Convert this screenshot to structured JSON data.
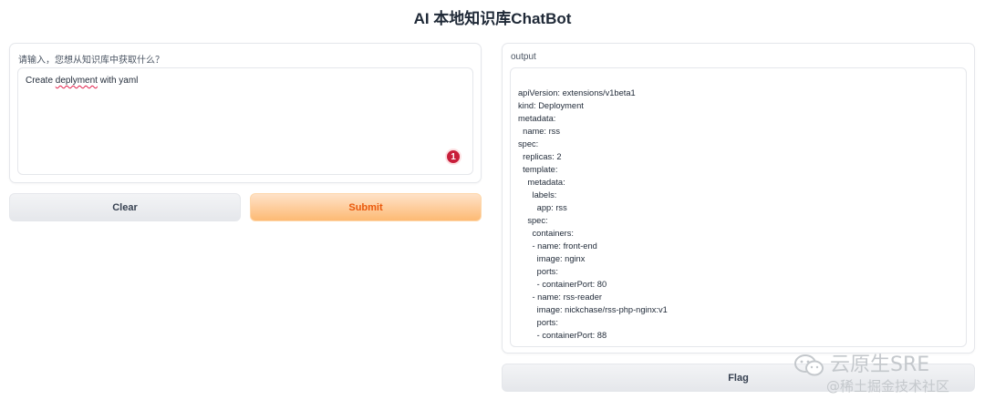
{
  "app": {
    "title": "AI 本地知识库ChatBot"
  },
  "input_panel": {
    "label": "请输入，您想从知识库中获取什么？",
    "value_prefix": "Create ",
    "value_misspelled": "deplyment",
    "value_suffix": " with yaml",
    "badge_count": "1"
  },
  "buttons": {
    "clear": "Clear",
    "submit": "Submit",
    "flag": "Flag"
  },
  "output_panel": {
    "label": "output",
    "lines": [
      "apiVersion: extensions/v1beta1",
      "kind: Deployment",
      "metadata:",
      "  name: rss",
      "spec:",
      "  replicas: 2",
      "  template:",
      "    metadata:",
      "      labels:",
      "        app: rss",
      "    spec:",
      "      containers:",
      "      - name: front-end",
      "        image: nginx",
      "        ports:",
      "        - containerPort: 80",
      "      - name: rss-reader",
      "        image: nickchase/rss-php-nginx:v1",
      "        ports:",
      "        - containerPort: 88"
    ]
  },
  "watermark": {
    "line1": "云原生SRE",
    "line2": "@稀土掘金技术社区"
  }
}
